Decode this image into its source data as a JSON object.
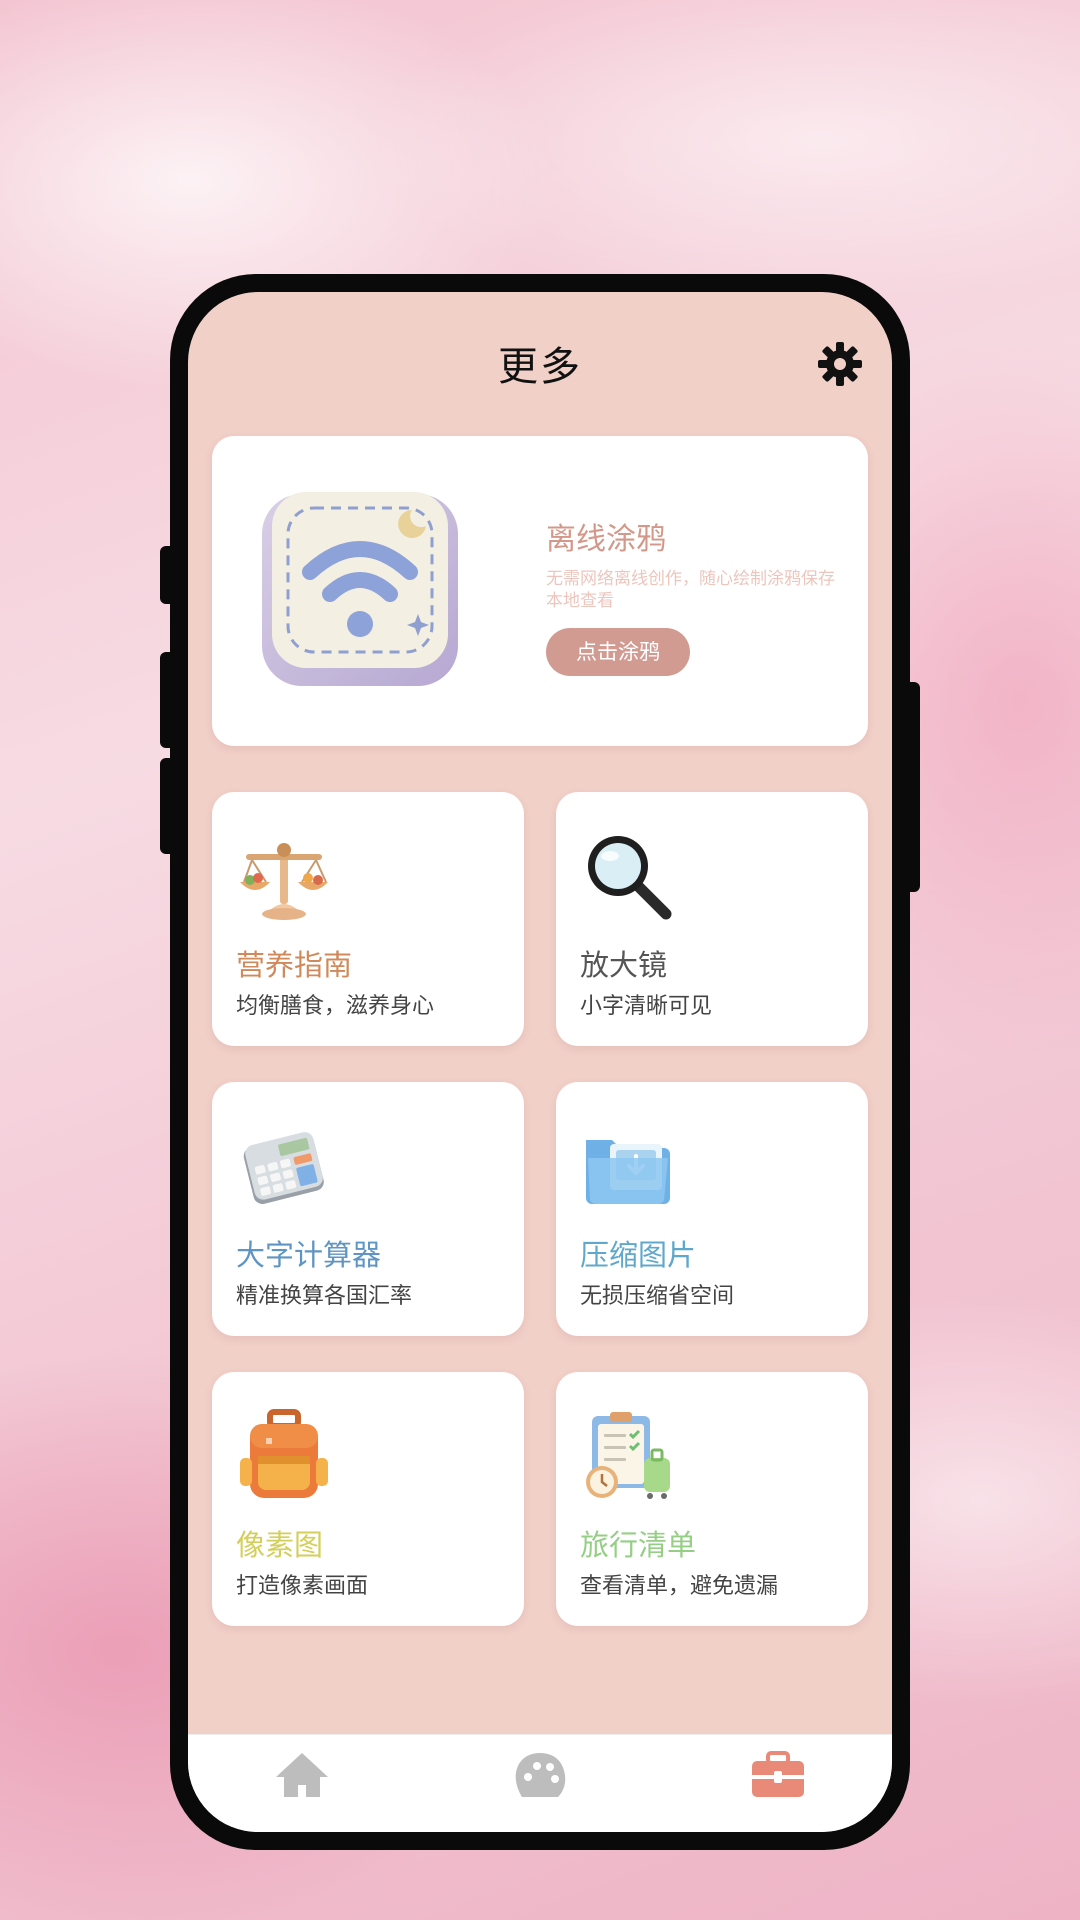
{
  "header": {
    "title": "更多",
    "settings_icon": "gear-icon"
  },
  "banner": {
    "title": "离线涂鸦",
    "description": "无需网络离线创作，随心绘制涂鸦保存本地查看",
    "button_label": "点击涂鸦",
    "icon": "wifi-tile-icon"
  },
  "tools": [
    {
      "title": "营养指南",
      "subtitle": "均衡膳食，滋养身心",
      "icon": "balance-scale-icon",
      "title_color": "#d0895a"
    },
    {
      "title": "放大镜",
      "subtitle": "小字清晰可见",
      "icon": "magnifier-icon",
      "title_color": "#555555"
    },
    {
      "title": "大字计算器",
      "subtitle": "精准换算各国汇率",
      "icon": "calculator-icon",
      "title_color": "#5f95c3"
    },
    {
      "title": "压缩图片",
      "subtitle": "无损压缩省空间",
      "icon": "folder-image-icon",
      "title_color": "#5fa8cc"
    },
    {
      "title": "像素图",
      "subtitle": "打造像素画面",
      "icon": "backpack-icon",
      "title_color": "#d4cf5a"
    },
    {
      "title": "旅行清单",
      "subtitle": "查看清单，避免遗漏",
      "icon": "travel-checklist-icon",
      "title_color": "#95cf86"
    }
  ],
  "bottom_nav": [
    {
      "icon": "home-icon",
      "active": false
    },
    {
      "icon": "palette-icon",
      "active": false
    },
    {
      "icon": "toolbox-icon",
      "active": true
    }
  ],
  "colors": {
    "screen_bg": "#f1d0c8",
    "accent": "#d29b92",
    "nav_inactive": "#bdbdbd",
    "nav_active": "#e98a78"
  }
}
